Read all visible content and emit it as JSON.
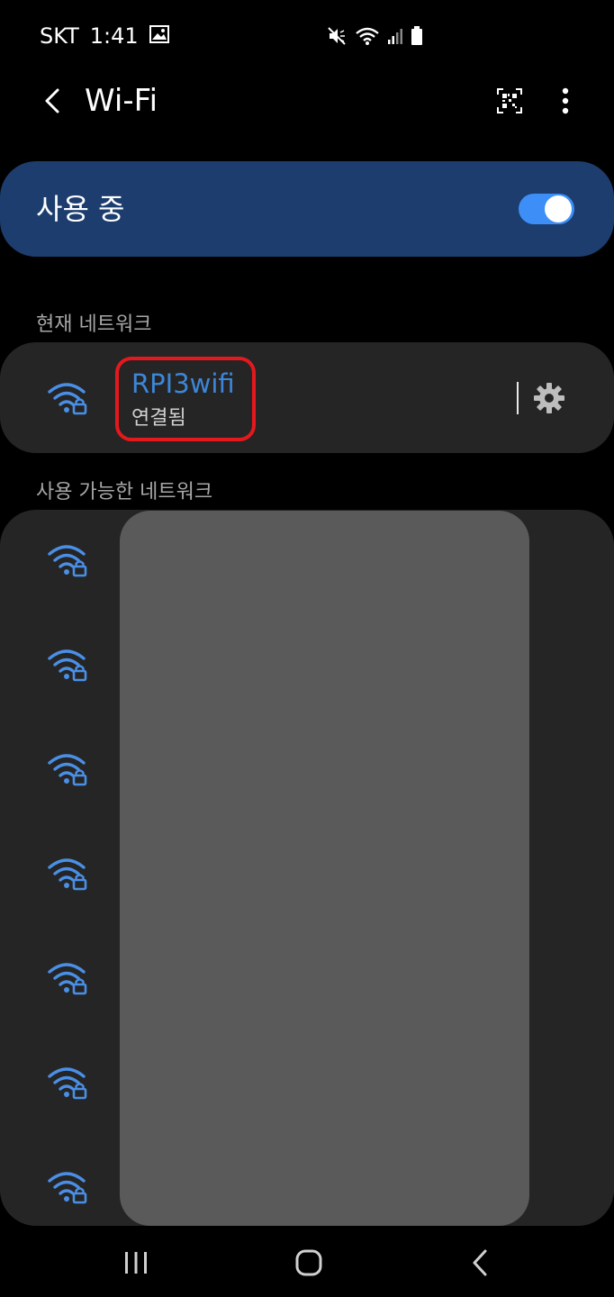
{
  "status_bar": {
    "carrier": "SKT",
    "time": "1:41"
  },
  "header": {
    "title": "Wi-Fi"
  },
  "master_toggle": {
    "label": "사용 중",
    "enabled": true,
    "accent_color": "#3d8ff7",
    "card_color": "#1c3d6e"
  },
  "current_section": {
    "header": "현재 네트워크",
    "network": {
      "name": "RPI3wifi",
      "status": "연결됨",
      "name_color": "#3d86d8"
    }
  },
  "available_section": {
    "header": "사용 가능한 네트워크",
    "network_count_visible": 7
  },
  "annotation": {
    "highlight_color": "#e3191e"
  }
}
